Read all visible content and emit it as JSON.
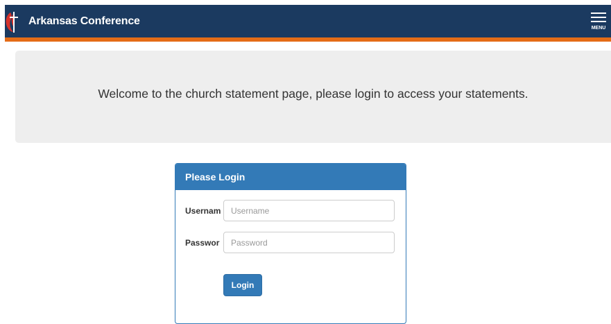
{
  "header": {
    "title": "Arkansas Conference",
    "logo_icon": "cross-and-flame-icon",
    "menu_label": "MENU",
    "menu_icon": "hamburger-menu-icon",
    "colors": {
      "bar": "#1b3a60",
      "accent": "#e46c17"
    }
  },
  "jumbotron": {
    "message": "Welcome to the church statement page, please login to access your statements."
  },
  "login_panel": {
    "title": "Please Login",
    "username_label": "Usernam",
    "username_placeholder": "Username",
    "username_value": "",
    "password_label": "Passwor",
    "password_placeholder": "Password",
    "password_value": "",
    "submit_label": "Login",
    "colors": {
      "primary": "#337ab7"
    }
  }
}
